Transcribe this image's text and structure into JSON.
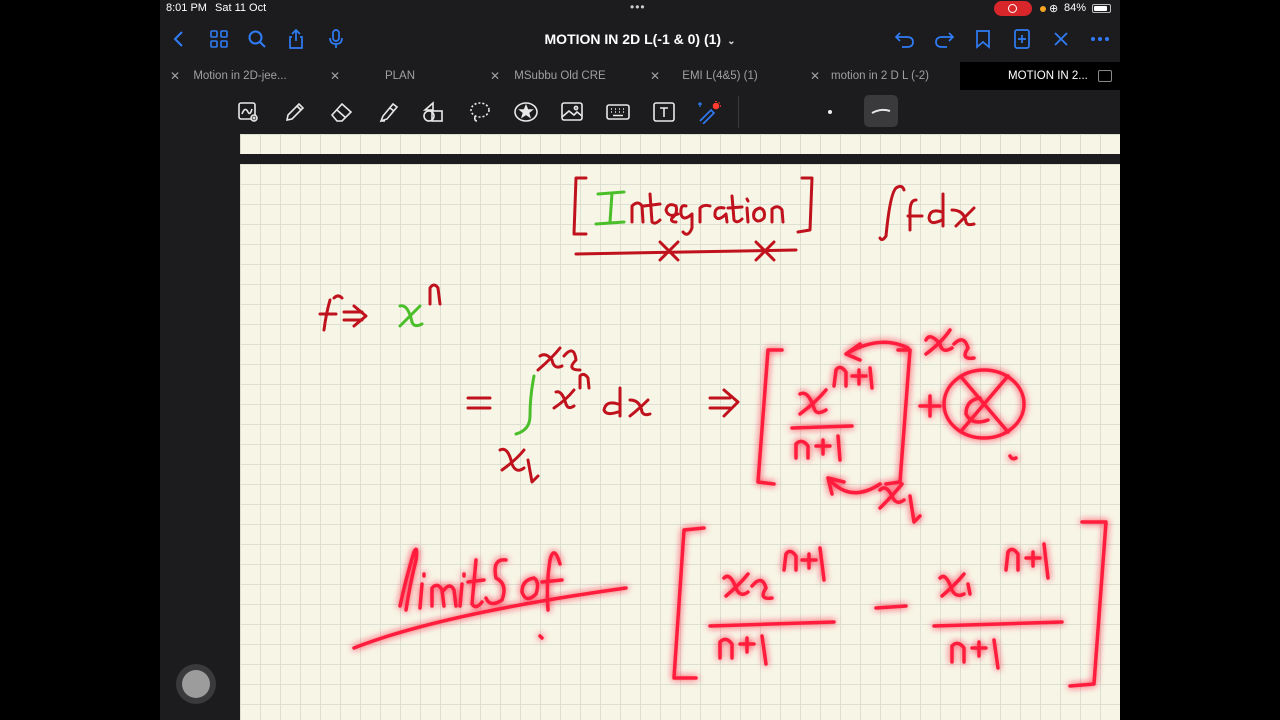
{
  "status": {
    "time": "8:01 PM",
    "date": "Sat 11 Oct",
    "battery": "84%",
    "battery_level": 0.84
  },
  "document": {
    "title": "MOTION IN 2D L(-1 & 0) (1)"
  },
  "tabs": [
    {
      "label": "Motion in 2D-jee..."
    },
    {
      "label": "PLAN"
    },
    {
      "label": "MSubbu Old CRE"
    },
    {
      "label": "EMI L(4&5) (1)"
    },
    {
      "label": "motion in 2 D L (-2)"
    },
    {
      "label": "MOTION IN 2..."
    }
  ],
  "colors": {
    "accent": "#2f7cf6",
    "ink_red": "#c0121d",
    "ink_green": "#4bbf2a",
    "paper": "#f7f5e6",
    "glow": "#ff1f3d"
  },
  "icons": {
    "nav": [
      "back-icon",
      "grid-icon",
      "search-icon",
      "share-icon",
      "microphone-icon",
      "undo-icon",
      "redo-icon",
      "bookmark-icon",
      "add-page-icon",
      "close-icon",
      "more-icon"
    ],
    "tools": [
      "lasso-selection-icon",
      "pen-icon",
      "eraser-icon",
      "highlighter-icon",
      "shapes-icon",
      "lasso-icon",
      "sticker-icon",
      "image-icon",
      "keyboard-icon",
      "text-box-icon",
      "laser-pointer-icon"
    ]
  }
}
